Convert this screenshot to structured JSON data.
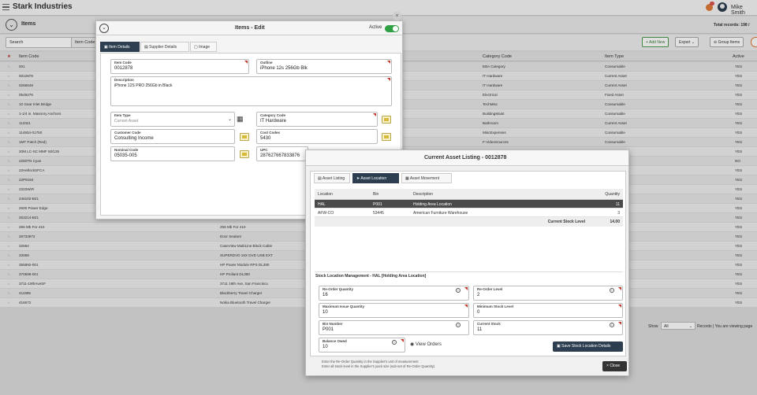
{
  "app": {
    "title": "Stark Industries",
    "user": "Mike Smith"
  },
  "page": {
    "title": "Items",
    "total_records": "Total records: 198 /"
  },
  "toolbar": {
    "search_label": "Search",
    "filter_field": "Item Code",
    "add_new": "+ Add New",
    "export": "Export",
    "group_items": "Group Items"
  },
  "table": {
    "headers": [
      "Item Code",
      "Category Code",
      "Item Type",
      "Active"
    ],
    "rows": [
      {
        "code": "001",
        "desc": "",
        "cat": "EBA Category",
        "type": "Consumable",
        "active": "YES"
      },
      {
        "code": "0012878",
        "desc": "",
        "cat": "IT Hardware",
        "type": "Current Asset",
        "active": "YES"
      },
      {
        "code": "0266649",
        "desc": "",
        "cat": "IT Hardware",
        "type": "Current Asset",
        "active": "YES"
      },
      {
        "code": "0549276",
        "desc": "",
        "cat": "Electrical",
        "type": "Fixed Asset",
        "active": "YES"
      },
      {
        "code": "10 Gear Inlet Bridge",
        "desc": "",
        "cat": "TechMisc",
        "type": "Consumable",
        "active": "YES"
      },
      {
        "code": "1-1/4 in. Masonry Anchors",
        "desc": "",
        "cat": "BuildingMaint",
        "type": "Consumable",
        "active": "YES"
      },
      {
        "code": "113321",
        "desc": "",
        "cat": "Bathroom",
        "type": "Current Asset",
        "active": "YES"
      },
      {
        "code": "114934-01750",
        "desc": "",
        "cat": "MiscExpenses",
        "type": "Consumable",
        "active": "YES"
      },
      {
        "code": "1MT Patch (Red)",
        "desc": "",
        "cat": "F-VideoSources",
        "type": "Consumable",
        "active": "YES"
      },
      {
        "code": "20M LC-SC MMF 50/125",
        "desc": "",
        "cat": "",
        "type": "",
        "active": "YES"
      },
      {
        "code": "2250TN Cyan",
        "desc": "",
        "cat": "",
        "type": "",
        "active": "NO"
      },
      {
        "code": "22HellockSFCA",
        "desc": "",
        "cat": "",
        "type": "",
        "active": "YES"
      },
      {
        "code": "22P9194",
        "desc": "",
        "cat": "",
        "type": "",
        "active": "YES"
      },
      {
        "code": "2323WiFi",
        "desc": "",
        "cat": "",
        "type": "",
        "active": "YES"
      },
      {
        "code": "246102-B21",
        "desc": "",
        "cat": "",
        "type": "",
        "active": "YES"
      },
      {
        "code": "2500 Power Edge",
        "desc": "",
        "cat": "",
        "type": "",
        "active": "YES"
      },
      {
        "code": "253214-B21",
        "desc": "HP Server Rack Panel",
        "cat": "",
        "type": "",
        "active": "YES"
      },
      {
        "code": "256 Mb For 410",
        "desc": "256 Mb For 410",
        "cat": "",
        "type": "",
        "active": "YES"
      },
      {
        "code": "28733972",
        "desc": "Door Sealant",
        "cat": "",
        "type": "",
        "active": "YES"
      },
      {
        "code": "32594",
        "desc": "CaseView MultiLine Block Cable",
        "cat": "",
        "type": "",
        "active": "YES"
      },
      {
        "code": "33068",
        "desc": "SUPERDVD 16X DVD USB EXT",
        "cat": "",
        "type": "",
        "active": "YES"
      },
      {
        "code": "355892-001",
        "desc": "HP Power Module RPS DL380",
        "cat": "",
        "type": "",
        "active": "YES"
      },
      {
        "code": "370596-001",
        "desc": "HP Proliant DL380",
        "cat": "",
        "type": "",
        "active": "YES"
      },
      {
        "code": "3711-19thAveSF",
        "desc": "3711 19th Ave, San Francisco",
        "cat": "",
        "type": "",
        "active": "YES"
      },
      {
        "code": "411895",
        "desc": "Blackberry Travel Charger",
        "cat": "",
        "type": "",
        "active": "YES"
      },
      {
        "code": "416672",
        "desc": "Nokia Bluetooth Travel Charger",
        "cat": "",
        "type": "",
        "active": "YES"
      }
    ]
  },
  "footer": {
    "show": "Show",
    "show_value": "All",
    "records_text": "Records | You are viewing page"
  },
  "edit_modal": {
    "title": "Items - Edit",
    "active_label": "Active",
    "tabs": [
      "Item Details",
      "Supplier Details",
      "Image"
    ],
    "fields": {
      "item_code": {
        "label": "Item Code",
        "value": "0012878"
      },
      "outline": {
        "label": "Outline",
        "value": "iPhone 12s 256Gb Blk"
      },
      "description": {
        "label": "Description",
        "value": "iPhone 12S PRO 256Gb in Black"
      },
      "item_type": {
        "label": "Item Type",
        "value": "Current Asset"
      },
      "category_code": {
        "label": "Category Code",
        "value": "IT Hardware"
      },
      "customer_code": {
        "label": "Customer Code",
        "value": "Consulting Income"
      },
      "cost_codes": {
        "label": "Cost Codes",
        "value": "5430"
      },
      "nominal_code": {
        "label": "Nominal Code",
        "value": "05035-005"
      },
      "upc": {
        "label": "UPC",
        "value": "287627667833876"
      }
    }
  },
  "asset_modal": {
    "title": "Current Asset Listing - 0012878",
    "tabs": [
      "Asset Listing",
      "Asset Location",
      "Asset Movement"
    ],
    "columns": [
      "Location",
      "Bin",
      "Description",
      "Quantity"
    ],
    "rows": [
      {
        "location": "HAL",
        "bin": "P001",
        "desc": "Holding Area Location",
        "qty": "11"
      },
      {
        "location": "AFW-CO",
        "bin": "53445",
        "desc": "American Furniture Warehouse",
        "qty": "3"
      }
    ],
    "total_label": "Current Stock Level",
    "total_value": "14.00",
    "section_title": "Stock Location Management - HAL [Holding Area Location]",
    "fields": {
      "reorder_qty": {
        "label": "Re-Order Quantity",
        "value": "16"
      },
      "reorder_level": {
        "label": "Re-Order Level",
        "value": "2"
      },
      "max_issue": {
        "label": "Maximum Issue Quantity",
        "value": "10"
      },
      "min_stock": {
        "label": "Minimum Stock Level",
        "value": "0"
      },
      "bin_number": {
        "label": "Bin Number",
        "value": "P001"
      },
      "current_stock": {
        "label": "Current Stock",
        "value": "11"
      },
      "balance_owed": {
        "label": "Balance Owed",
        "value": "10"
      }
    },
    "view_orders": "View Orders",
    "save_label": "Save Stock Location Details",
    "hint_1": "Enter the Re-Order Quantity in the Supplier's unit of measurement",
    "hint_2": "Enter all stock level in the Supplier's pack size (sub-set of Re-Order Quantity)",
    "close_label": "Close"
  },
  "colors": {
    "accent": "#2c3e50",
    "active_toggle": "#2ea043",
    "required": "#c0392b"
  }
}
